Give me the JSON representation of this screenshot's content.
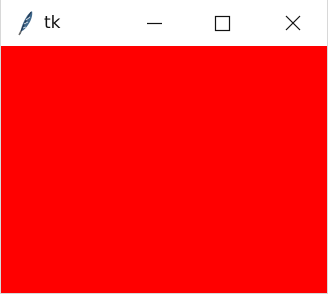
{
  "window": {
    "title": "tk",
    "app_icon": "feather-icon",
    "controls": {
      "minimize_icon": "minimize-icon",
      "maximize_icon": "maximize-icon",
      "close_icon": "close-icon"
    },
    "client_background": "#ff0000"
  }
}
